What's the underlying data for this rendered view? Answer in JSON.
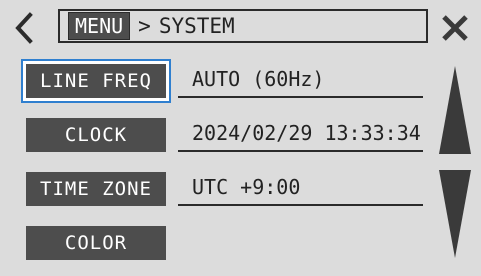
{
  "header": {
    "menu_label": "MENU",
    "separator": ">",
    "current": "SYSTEM",
    "back_icon": "chevron-left-icon",
    "close_icon": "close-icon"
  },
  "rows": [
    {
      "label": "LINE FREQ",
      "value": "AUTO (60Hz)",
      "selected": true
    },
    {
      "label": "CLOCK",
      "value": "2024/02/29 13:33:34",
      "selected": false
    },
    {
      "label": "TIME ZONE",
      "value": "UTC +9:00",
      "selected": false
    },
    {
      "label": "COLOR",
      "value": "",
      "selected": false
    }
  ],
  "scroll": {
    "up_icon": "triangle-up-icon",
    "down_icon": "triangle-down-icon"
  },
  "colors": {
    "background": "#dcdcdc",
    "button": "#4d4d4d",
    "selection": "#2f7fcf",
    "text": "#222222"
  }
}
